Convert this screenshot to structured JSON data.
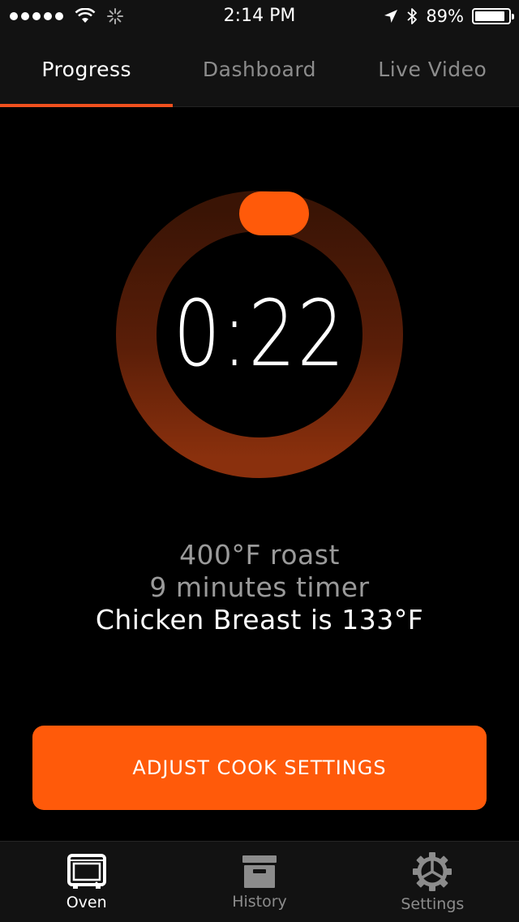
{
  "status_bar": {
    "time": "2:14 PM",
    "battery_percent": "89%",
    "battery_level": 0.89
  },
  "tabs": [
    {
      "label": "Progress",
      "active": true
    },
    {
      "label": "Dashboard",
      "active": false
    },
    {
      "label": "Live Video",
      "active": false
    }
  ],
  "timer": {
    "display": "0:22",
    "progress": 0.0
  },
  "cook_info": {
    "mode": "400°F roast",
    "timer": "9 minutes timer",
    "probe": "Chicken Breast is 133°F"
  },
  "adjust_button": {
    "label": "ADJUST COOK SETTINGS"
  },
  "bottom_nav": [
    {
      "label": "Oven",
      "icon": "oven-icon",
      "active": true
    },
    {
      "label": "History",
      "icon": "archive-box-icon",
      "active": false
    },
    {
      "label": "Settings",
      "icon": "gear-icon",
      "active": false
    }
  ],
  "colors": {
    "accent": "#ff5a0a",
    "ring_dark": "#3a1405",
    "ring_light": "#7a2a0c",
    "background": "#000000",
    "bar_background": "#121212"
  }
}
